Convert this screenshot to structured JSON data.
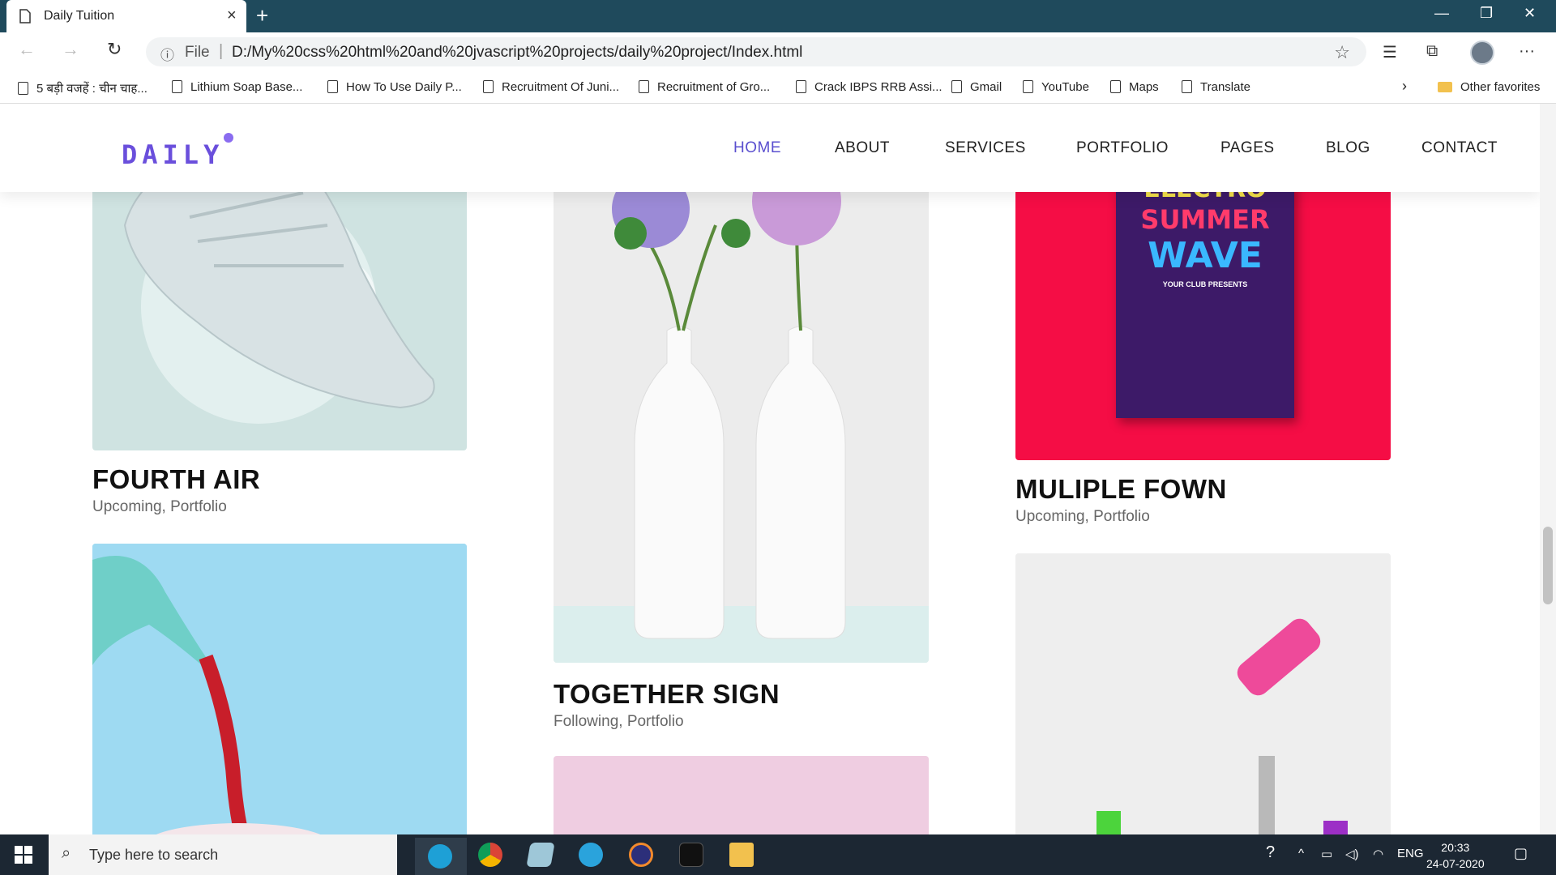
{
  "browser": {
    "tab_title": "Daily Tuition",
    "url_scheme": "File",
    "url": "D:/My%20css%20html%20and%20jvascript%20projects/daily%20project/Index.html",
    "bookmarks": [
      "5 बड़ी वजहें : चीन चाह...",
      "Lithium Soap Base...",
      "How To Use Daily P...",
      "Recruitment Of Juni...",
      "Recruitment of Gro...",
      "Crack IBPS RRB Assi...",
      "Gmail",
      "YouTube",
      "Maps",
      "Translate"
    ],
    "other_favorites": "Other favorites"
  },
  "site": {
    "logo": "DAILY",
    "nav": [
      "HOME",
      "ABOUT",
      "SERVICES",
      "PORTFOLIO",
      "PAGES",
      "BLOG",
      "CONTACT"
    ],
    "accent": "#5a4fcf",
    "cards": [
      {
        "title": "FOURTH AIR",
        "sub": "Upcoming, Portfolio"
      },
      {
        "title": "TOGETHER SIGN",
        "sub": "Following, Portfolio"
      },
      {
        "title": "MULIPLE FOWN",
        "sub": "Upcoming, Portfolio"
      }
    ],
    "poster": {
      "line1": "ELECTRO",
      "line2": "SUMMER",
      "line3": "WAVE",
      "small": "YOUR CLUB PRESENTS"
    }
  },
  "taskbar": {
    "search_placeholder": "Type here to search",
    "lang": "ENG",
    "time": "20:33",
    "date": "24-07-2020"
  }
}
